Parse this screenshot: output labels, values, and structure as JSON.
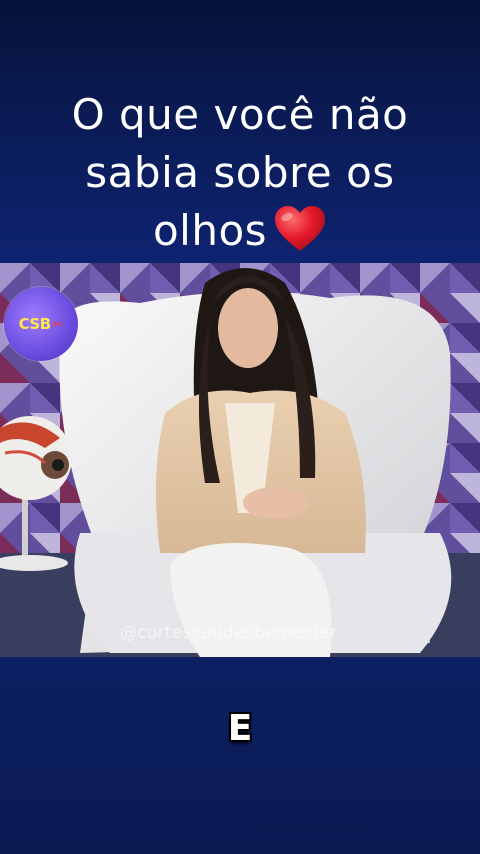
{
  "title": {
    "line1": "O que você não",
    "line2": "sabia sobre os",
    "line3": "olhos"
  },
  "title_icon": "red-heart-emoji",
  "badge": {
    "text": "CSB",
    "icon": "scissors-icon"
  },
  "video": {
    "watermark": "@cortessaudesbemestar"
  },
  "caption": "E",
  "colors": {
    "background": "#0d2168",
    "title_text": "#ffffff",
    "heart": "#e3192b",
    "badge_bg": "#7a5cf0",
    "badge_text": "#ffe84a"
  }
}
